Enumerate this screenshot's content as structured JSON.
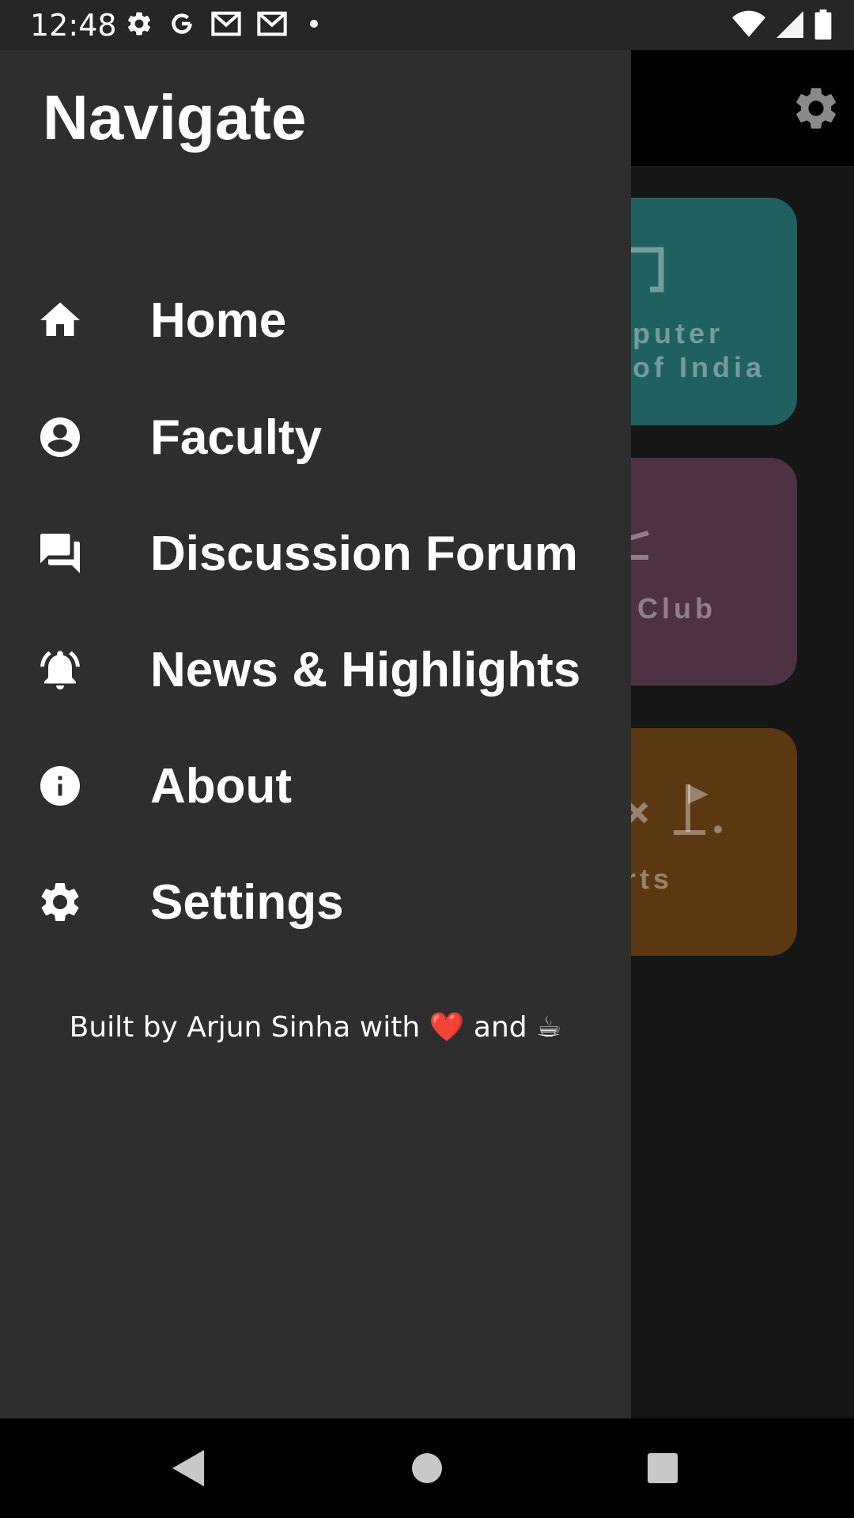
{
  "status_bar": {
    "time": "12:48",
    "left_icons": [
      "gear-icon",
      "google-icon",
      "gmail-icon",
      "gmail-icon",
      "dot-icon"
    ],
    "right_icons": [
      "wifi-icon",
      "signal-icon",
      "battery-icon"
    ]
  },
  "drawer": {
    "title": "Navigate",
    "items": [
      {
        "label": "Home",
        "icon": "home-icon"
      },
      {
        "label": "Faculty",
        "icon": "account-circle-icon"
      },
      {
        "label": "Discussion Forum",
        "icon": "forum-icon"
      },
      {
        "label": "News & Highlights",
        "icon": "bell-ring-icon"
      },
      {
        "label": "About",
        "icon": "info-icon"
      },
      {
        "label": "Settings",
        "icon": "gear-icon"
      }
    ],
    "footer": {
      "prefix": "Built by Arjun Sinha with ",
      "heart": "❤️",
      "middle": " and ",
      "coffee": "☕"
    }
  },
  "background": {
    "settings_icon": "gear-icon",
    "cards": [
      {
        "text": "puter\nof India",
        "color": "#206060",
        "icon": "monitor-icon"
      },
      {
        "text": "Club",
        "color": "#4e3143",
        "icon": "tool-icon"
      },
      {
        "text": "rts",
        "color": "#5a3812",
        "icon": "golf-icon"
      }
    ]
  },
  "nav_bar": {
    "buttons": [
      "back-icon",
      "home-circle-icon",
      "recents-icon"
    ]
  }
}
